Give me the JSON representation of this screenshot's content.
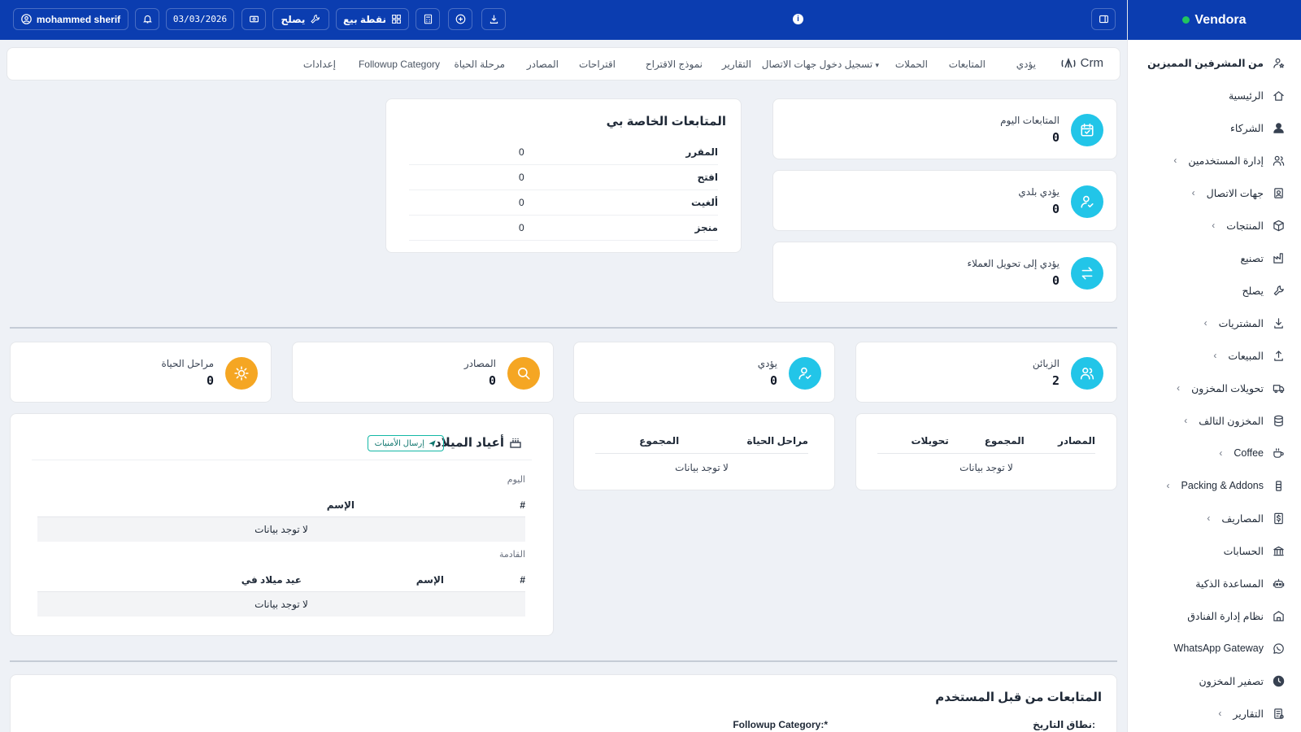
{
  "brand": {
    "name": "Vendora"
  },
  "topbar": {
    "user": "mohammed sherif",
    "date": "03/03/2026",
    "repair": "يصلح",
    "pos": "نقطة بيع"
  },
  "tabs": [
    "Crm",
    "يؤدي",
    "المتابعات",
    "الحملات",
    "تسجيل دخول جهات الاتصال",
    "التقارير",
    "نموذج الاقتراح",
    "اقتراحات",
    "المصادر",
    "مرحلة الحياة",
    "Followup Category",
    "إعدادات"
  ],
  "sidebar": {
    "items": [
      {
        "label": "من المشرفين المميزين",
        "icon": "user-star-icon",
        "bold": true
      },
      {
        "label": "الرئيسية",
        "icon": "home-icon"
      },
      {
        "label": "الشركاء",
        "icon": "person-icon"
      },
      {
        "label": "إدارة المستخدمين",
        "icon": "users-icon",
        "sub": true
      },
      {
        "label": "جهات الاتصال",
        "icon": "contacts-icon",
        "sub": true
      },
      {
        "label": "المنتجات",
        "icon": "box-icon",
        "sub": true
      },
      {
        "label": "تصنيع",
        "icon": "factory-icon"
      },
      {
        "label": "يصلح",
        "icon": "wrench-icon"
      },
      {
        "label": "المشتريات",
        "icon": "download-icon",
        "sub": true
      },
      {
        "label": "المبيعات",
        "icon": "upload-icon",
        "sub": true
      },
      {
        "label": "تحويلات المخزون",
        "icon": "truck-icon",
        "sub": true
      },
      {
        "label": "المخزون التالف",
        "icon": "database-icon",
        "sub": true
      },
      {
        "label": "Coffee",
        "icon": "coffee-icon",
        "sub": true
      },
      {
        "label": "Packing & Addons",
        "icon": "package-icon",
        "sub": true
      },
      {
        "label": "المصاريف",
        "icon": "dollar-icon",
        "sub": true
      },
      {
        "label": "الحسابات",
        "icon": "bank-icon"
      },
      {
        "label": "المساعدة الذكية",
        "icon": "robot-icon"
      },
      {
        "label": "نظام إدارة الفنادق",
        "icon": "hotel-icon"
      },
      {
        "label": "WhatsApp Gateway",
        "icon": "whatsapp-icon"
      },
      {
        "label": "تصفير المخزون",
        "icon": "clock-icon"
      },
      {
        "label": "التقارير",
        "icon": "report-icon",
        "sub": true
      }
    ]
  },
  "stats_top": [
    {
      "label": "المتابعات اليوم",
      "value": "0"
    },
    {
      "label": "يؤدي بلدي",
      "value": "0"
    },
    {
      "label": "يؤدي إلى تحويل العملاء",
      "value": "0"
    }
  ],
  "my_followups": {
    "title": "المتابعات الخاصة بي",
    "rows": [
      {
        "k": "المقرر",
        "v": "0"
      },
      {
        "k": "افتح",
        "v": "0"
      },
      {
        "k": "ألغيت",
        "v": "0"
      },
      {
        "k": "منجز",
        "v": "0"
      }
    ]
  },
  "stats_mid": [
    {
      "label": "الزبائن",
      "value": "2"
    },
    {
      "label": "يؤدي",
      "value": "0"
    },
    {
      "label": "المصادر",
      "value": "0"
    },
    {
      "label": "مراحل الحياة",
      "value": "0"
    }
  ],
  "sources_table": {
    "cols": [
      "المصادر",
      "المجموع",
      "تحويلات"
    ],
    "empty": "لا توجد بيانات"
  },
  "life_table": {
    "cols": [
      "مراحل الحياة",
      "المجموع"
    ],
    "empty": "لا توجد بيانات"
  },
  "birthdays": {
    "title": "أعياد الميلاد",
    "send": "إرسال الأمنيات",
    "today": "اليوم",
    "today_cols": [
      "#",
      "الإسم"
    ],
    "upcoming": "القادمة",
    "upcoming_cols": [
      "#",
      "الإسم",
      "عيد ميلاد في"
    ],
    "empty": "لا توجد بيانات"
  },
  "user_followups": {
    "title": "المتابعات من قبل المستخدم",
    "date_range": "نطاق التاريخ:",
    "category": "Followup Category:*"
  },
  "colors": {
    "primary": "#0b3db0",
    "cyan": "#22c5e8",
    "orange": "#f5a623"
  }
}
